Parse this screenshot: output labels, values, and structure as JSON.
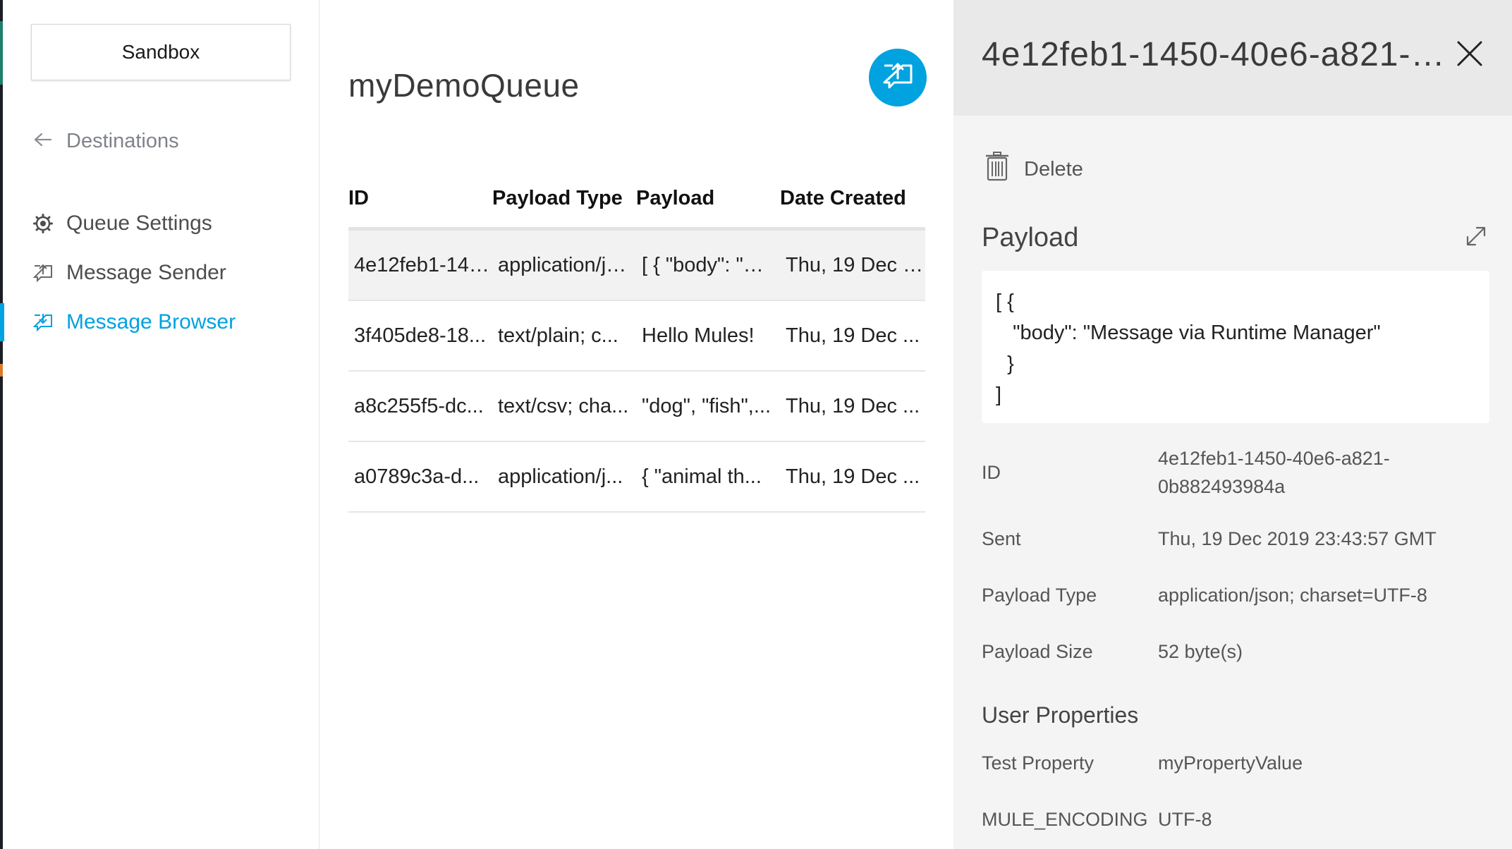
{
  "sidebar": {
    "environment": "Sandbox",
    "back_label": "Destinations",
    "items": [
      {
        "label": "Queue Settings",
        "icon": "gear-icon"
      },
      {
        "label": "Message Sender",
        "icon": "send-message-icon"
      },
      {
        "label": "Message Browser",
        "icon": "browse-message-icon",
        "active": true
      }
    ]
  },
  "main": {
    "title": "myDemoQueue",
    "send_button_icon": "send-message-icon",
    "columns": [
      "ID",
      "Payload Type",
      "Payload",
      "Date Created"
    ],
    "rows": [
      {
        "id": "4e12feb1-1450-40e6-a821-0b882493984a",
        "type": "application/json; charset=UTF-8",
        "payload": "[ { \"body\": \"Message via Runtime Manager\" } ]",
        "date": "Thu, 19 Dec 2019 23:43:57 GMT"
      },
      {
        "id": "3f405de8-18...",
        "type": "text/plain; c...",
        "payload": "Hello Mules!",
        "date": "Thu, 19 Dec ..."
      },
      {
        "id": "a8c255f5-dc...",
        "type": "text/csv; cha...",
        "payload": "\"dog\", \"fish\",...",
        "date": "Thu, 19 Dec ..."
      },
      {
        "id": "a0789c3a-d...",
        "type": "application/j...",
        "payload": "{ \"animal th...",
        "date": "Thu, 19 Dec ..."
      }
    ]
  },
  "detail": {
    "title": "4e12feb1-1450-40e6-a821-0b882493984a",
    "delete_label": "Delete",
    "payload_label": "Payload",
    "payload_text": "[ {\n   \"body\": \"Message via Runtime Manager\"\n  }\n]",
    "fields": [
      {
        "key": "ID",
        "value": "4e12feb1-1450-40e6-a821-\n0b882493984a"
      },
      {
        "key": "Sent",
        "value": "Thu, 19 Dec 2019 23:43:57 GMT"
      },
      {
        "key": "Payload Type",
        "value": "application/json; charset=UTF-8"
      },
      {
        "key": "Payload Size",
        "value": "52 byte(s)"
      }
    ],
    "user_properties_label": "User Properties",
    "user_properties": [
      {
        "key": "Test Property",
        "value": "myPropertyValue"
      },
      {
        "key": "MULE_ENCODING",
        "value": "UTF-8"
      }
    ]
  },
  "colors": {
    "accent": "#00a2df",
    "detail_bg": "#f4f4f4",
    "detail_header_bg": "#e9e9e9",
    "selected_row": "#f2f2f2"
  }
}
